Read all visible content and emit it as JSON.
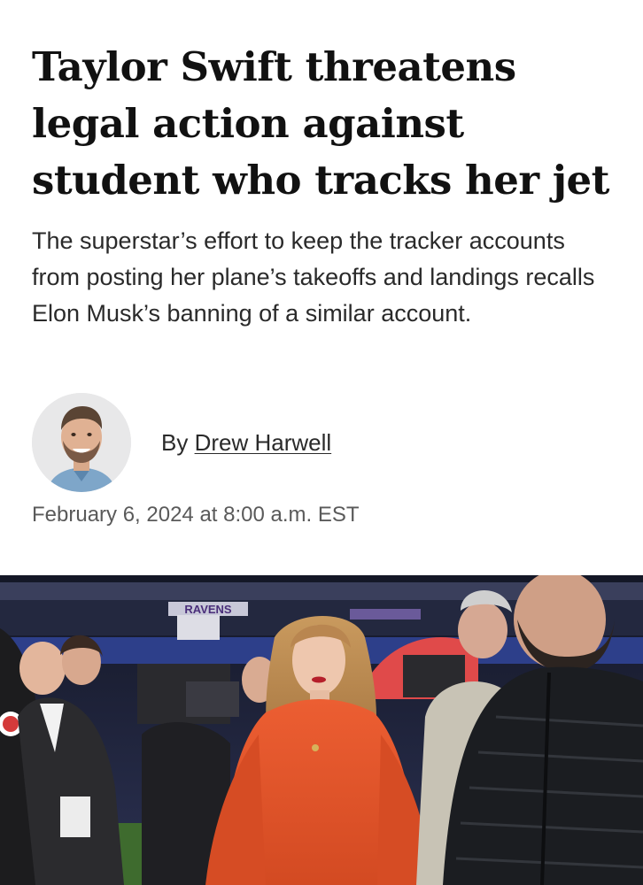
{
  "article": {
    "headline": "Taylor Swift threatens legal action against student who tracks her jet",
    "dek": "The superstar’s effort to keep the tracker accounts from posting her plane’s takeoffs and landings recalls Elon Musk’s banning of a similar account.",
    "byline_prefix": "By",
    "author": "Drew Harwell",
    "timestamp": "February 6, 2024 at 8:00 a.m. EST",
    "hero_stadium_sign": "RAVENS"
  },
  "colors": {
    "headline": "#111111",
    "dek": "#2a2a2a",
    "timestamp": "#5a5a5a",
    "sweater": "#e5552b",
    "stadium": "#1a1d2e"
  }
}
